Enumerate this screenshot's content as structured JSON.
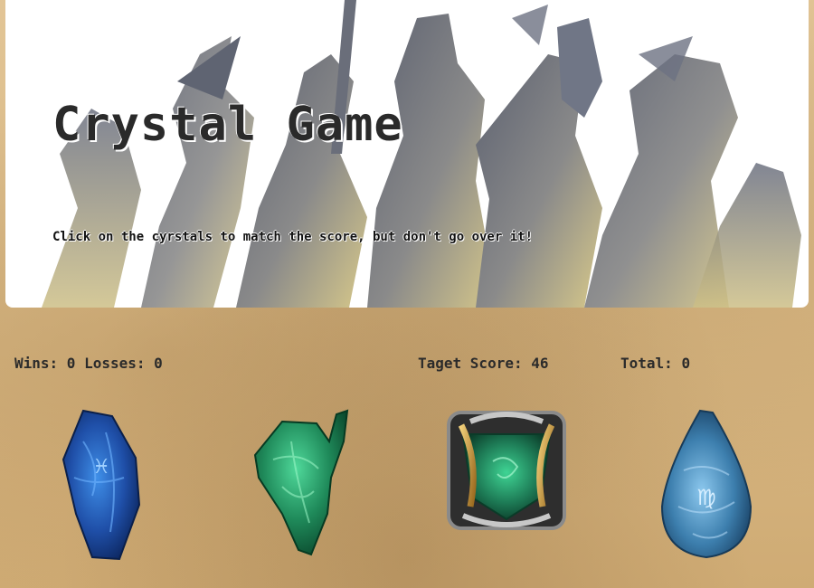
{
  "header": {
    "title": "Crystal Game",
    "subtitle": "Click on the cyrstals to match the score, but don't go over it!"
  },
  "scores": {
    "wins_label": "Wins:",
    "wins": "0",
    "losses_label": "Losses:",
    "losses": "0",
    "target_label": "Taget Score:",
    "target": "46",
    "total_label": "Total:",
    "total": "0"
  },
  "crystals": [
    {
      "name": "blue-crystal",
      "color": "#1f4fa8"
    },
    {
      "name": "green-crystal",
      "color": "#1f8a5a"
    },
    {
      "name": "framed-green-crystal",
      "color": "#1d7a55"
    },
    {
      "name": "light-blue-crystal",
      "color": "#3d7fae"
    }
  ],
  "colors": {
    "banner_bg": "#ffffff",
    "parchment": "#d9b985",
    "text": "#2b2b2b"
  }
}
